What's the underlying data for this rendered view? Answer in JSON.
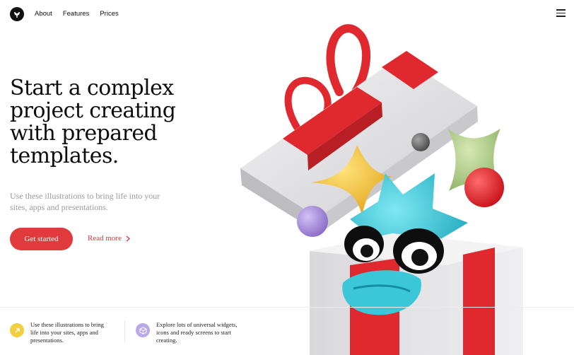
{
  "header": {
    "nav": [
      {
        "label": "About"
      },
      {
        "label": "Features"
      },
      {
        "label": "Prices"
      }
    ]
  },
  "hero": {
    "title_lines": [
      "Start a complex",
      "project creating",
      "with prepared",
      "templates."
    ],
    "subtitle_lines": [
      "Use these illustrations to bring life into your",
      "sites, apps and presentations."
    ],
    "primary_button": "Get started",
    "secondary_link": "Read more"
  },
  "features": [
    {
      "lines": [
        "Use these illustrations to bring",
        "life into your sites, apps and",
        "presentations."
      ],
      "icon": "arrow-up-right-icon",
      "color": "#f2cf3c"
    },
    {
      "lines": [
        "Explore lots of universal widgets,",
        "icons and ready screens to start",
        "creating."
      ],
      "icon": "cube-icon",
      "color": "#b9a8ea"
    }
  ],
  "colors": {
    "accent": "#e03a3c",
    "ribbon": "#e0292f",
    "box": "#e7e7e9",
    "teal_star": "#35c6d7",
    "yellow_star": "#f3c935",
    "green_star": "#b8d493",
    "purple_ball": "#a98fd6"
  },
  "illustration": {
    "icon": "gift-box-illustration"
  }
}
